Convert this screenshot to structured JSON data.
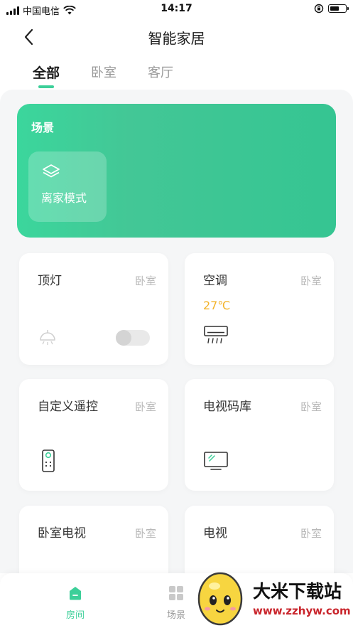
{
  "status_bar": {
    "carrier": "中国电信",
    "time": "14:17"
  },
  "nav": {
    "title": "智能家居"
  },
  "tabs": [
    {
      "label": "全部",
      "active": true
    },
    {
      "label": "卧室",
      "active": false
    },
    {
      "label": "客厅",
      "active": false
    }
  ],
  "scene": {
    "title": "场景",
    "mode_label": "离家模式",
    "mode_icon": "layers-icon"
  },
  "devices": [
    {
      "name": "顶灯",
      "room": "卧室",
      "icon": "lamp-icon",
      "switch_on": false
    },
    {
      "name": "空调",
      "room": "卧室",
      "temp": "27℃",
      "icon": "air-conditioner-icon"
    },
    {
      "name": "自定义遥控",
      "room": "卧室",
      "icon": "remote-icon"
    },
    {
      "name": "电视码库",
      "room": "卧室",
      "icon": "tv-icon"
    },
    {
      "name": "卧室电视",
      "room": "卧室"
    },
    {
      "name": "电视",
      "room": "卧室"
    }
  ],
  "bottom_nav": [
    {
      "label": "房间",
      "icon": "home-icon",
      "active": true
    },
    {
      "label": "场景",
      "icon": "grid-icon",
      "active": false
    }
  ],
  "watermark": {
    "text": "大米下载站",
    "url": "www.zzhyw.com"
  },
  "colors": {
    "accent": "#3ccf99",
    "temp": "#f3b32a",
    "muted": "#b8b8b8"
  }
}
